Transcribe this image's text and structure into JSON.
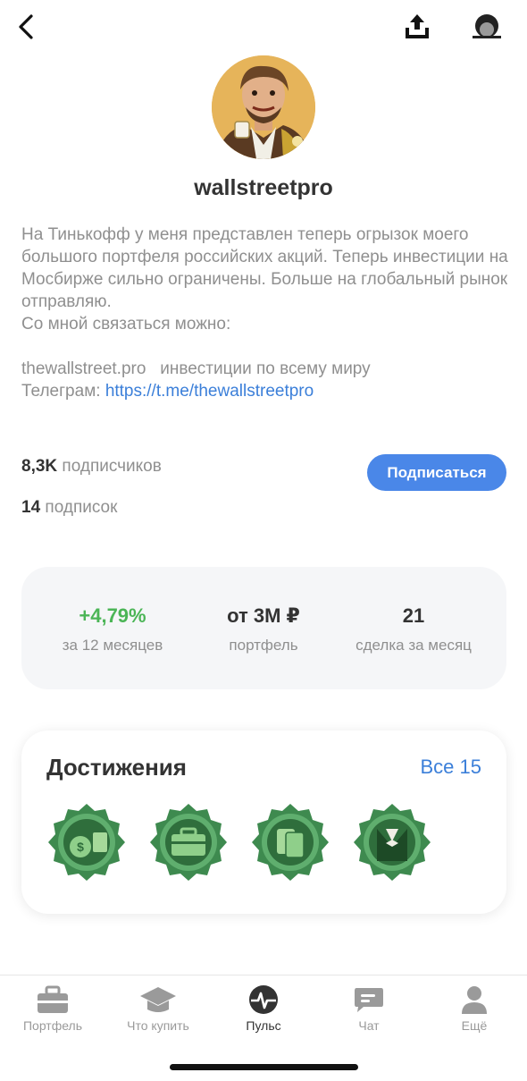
{
  "profile": {
    "username": "wallstreetpro",
    "bio_lines": [
      "На Тинькофф у меня представлен теперь огрызок моего большого портфеля российских акций. Теперь инвестиции на Мосбирже сильно ограничены. Больше на глобальный рынок отправляю.",
      "Со мной связаться можно:"
    ],
    "bio_site": "thewallstreet.pro   инвестиции по всему миру",
    "bio_telegram_prefix": "Телеграм: ",
    "bio_telegram_link": "https://t.me/thewallstreetpro"
  },
  "counts": {
    "subscribers_value": "8,3K",
    "subscribers_label": "подписчиков",
    "following_value": "14",
    "following_label": "подписок"
  },
  "subscribe_label": "Подписаться",
  "stats": [
    {
      "value": "+4,79%",
      "label": "за 12 месяцев"
    },
    {
      "value": "от 3М ₽",
      "label": "портфель"
    },
    {
      "value": "21",
      "label": "сделка за месяц"
    }
  ],
  "achievements": {
    "title": "Достижения",
    "all_label": "Все 15",
    "badges": [
      "money-badge-icon",
      "briefcase-badge-icon",
      "cards-badge-icon",
      "tuxedo-badge-icon"
    ]
  },
  "tabs": [
    {
      "label": "Портфель",
      "icon": "briefcase-icon",
      "active": false
    },
    {
      "label": "Что купить",
      "icon": "graduation-cap-icon",
      "active": false
    },
    {
      "label": "Пульс",
      "icon": "pulse-icon",
      "active": true
    },
    {
      "label": "Чат",
      "icon": "chat-icon",
      "active": false
    },
    {
      "label": "Ещё",
      "icon": "person-icon",
      "active": false
    }
  ],
  "colors": {
    "accent_blue": "#4a87e8",
    "link_blue": "#3b7fd9",
    "positive_green": "#4bb556",
    "badge_green": "#3e8a4f"
  }
}
